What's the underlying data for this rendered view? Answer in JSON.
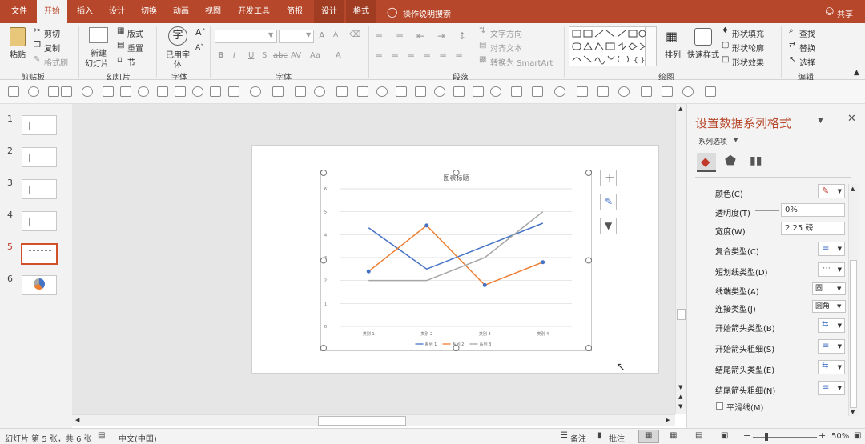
{
  "tabs": [
    {
      "label": "文件",
      "x": 8,
      "w": 32,
      "state": ""
    },
    {
      "label": "开始",
      "x": 46,
      "w": 38,
      "state": "active"
    },
    {
      "label": "插入",
      "x": 88,
      "w": 36,
      "state": ""
    },
    {
      "label": "设计",
      "x": 128,
      "w": 36,
      "state": ""
    },
    {
      "label": "切换",
      "x": 168,
      "w": 36,
      "state": ""
    },
    {
      "label": "动画",
      "x": 208,
      "w": 36,
      "state": ""
    },
    {
      "label": "视图",
      "x": 248,
      "w": 36,
      "state": ""
    },
    {
      "label": "开发工具",
      "x": 288,
      "w": 58,
      "state": ""
    },
    {
      "label": "简报",
      "x": 350,
      "w": 36,
      "state": ""
    },
    {
      "label": "设计",
      "x": 392,
      "w": 38,
      "state": "ctx"
    },
    {
      "label": "格式",
      "x": 432,
      "w": 38,
      "state": "ctx"
    }
  ],
  "search_label": "操作说明搜索",
  "share_label": "共享",
  "clipboard": {
    "paste": "粘贴",
    "cut": "剪切",
    "copy": "复制",
    "format_painter": "格式刷",
    "group": "剪贴板"
  },
  "slides_grp": {
    "new_slide": "新建",
    "new_slide2": "幻灯片",
    "layout": "版式",
    "reset": "重置",
    "section": "节",
    "group": "幻灯片"
  },
  "font_grp": {
    "use_font": "已用字",
    "use_font2": "体",
    "group": "字体",
    "glyph": "字"
  },
  "font": {
    "group": "字体",
    "bold": "B",
    "italic": "I",
    "underline": "U",
    "shadow": "S",
    "strike": "abc",
    "spacing": "AV",
    "case": "Aa",
    "color": "A",
    "grow": "A",
    "shrink": "A"
  },
  "paragraph": {
    "group": "段落",
    "text_dir": "文字方向",
    "align_text": "对齐文本",
    "smartart": "转换为 SmartArt"
  },
  "drawing": {
    "arrange": "排列",
    "quick_styles": "快速样式",
    "fill": "形状填充",
    "outline": "形状轮廓",
    "effect": "形状效果",
    "group": "绘图"
  },
  "editing": {
    "find": "查找",
    "replace": "替换",
    "select": "选择",
    "group": "编辑"
  },
  "slides": [
    {
      "num": "1"
    },
    {
      "num": "2"
    },
    {
      "num": "3"
    },
    {
      "num": "4"
    },
    {
      "num": "5"
    },
    {
      "num": "6"
    }
  ],
  "chart_data": {
    "type": "line",
    "title": "图表标题",
    "categories": [
      "类别 1",
      "类别 2",
      "类别 3",
      "类别 4"
    ],
    "series": [
      {
        "name": "系列 1",
        "values": [
          4.3,
          2.5,
          3.5,
          4.5
        ],
        "color": "#4472c4",
        "markers": false
      },
      {
        "name": "系列 2",
        "values": [
          2.4,
          4.4,
          1.8,
          2.8
        ],
        "color": "#ed7d31",
        "markers": true
      },
      {
        "name": "系列 3",
        "values": [
          2,
          2,
          3,
          5
        ],
        "color": "#a5a5a5",
        "markers": false
      }
    ],
    "ylim": [
      0,
      6
    ],
    "yticks": [
      "0",
      "1",
      "2",
      "3",
      "4",
      "5",
      "6"
    ],
    "grid": true,
    "legend": "bottom"
  },
  "pane": {
    "title": "设置数据系列格式",
    "series_options": "系列选项",
    "color": "颜色(C)",
    "transparency": "透明度(T)",
    "transparency_value": "0%",
    "width": "宽度(W)",
    "width_value": "2.25 磅",
    "compound": "复合类型(C)",
    "dash": "短划线类型(D)",
    "cap": "线端类型(A)",
    "cap_value": "圆",
    "join": "连接类型(J)",
    "join_value": "圆角",
    "begin_arrow_type": "开始箭头类型(B)",
    "begin_arrow_size": "开始箭头粗细(S)",
    "end_arrow_type": "结尾箭头类型(E)",
    "end_arrow_size": "结尾箭头粗细(N)",
    "smooth": "平滑线(M)"
  },
  "status": {
    "slide_info": "幻灯片 第 5 张，共 6 张",
    "language": "中文(中国)",
    "notes": "备注",
    "comments": "批注",
    "zoom": "50%"
  }
}
